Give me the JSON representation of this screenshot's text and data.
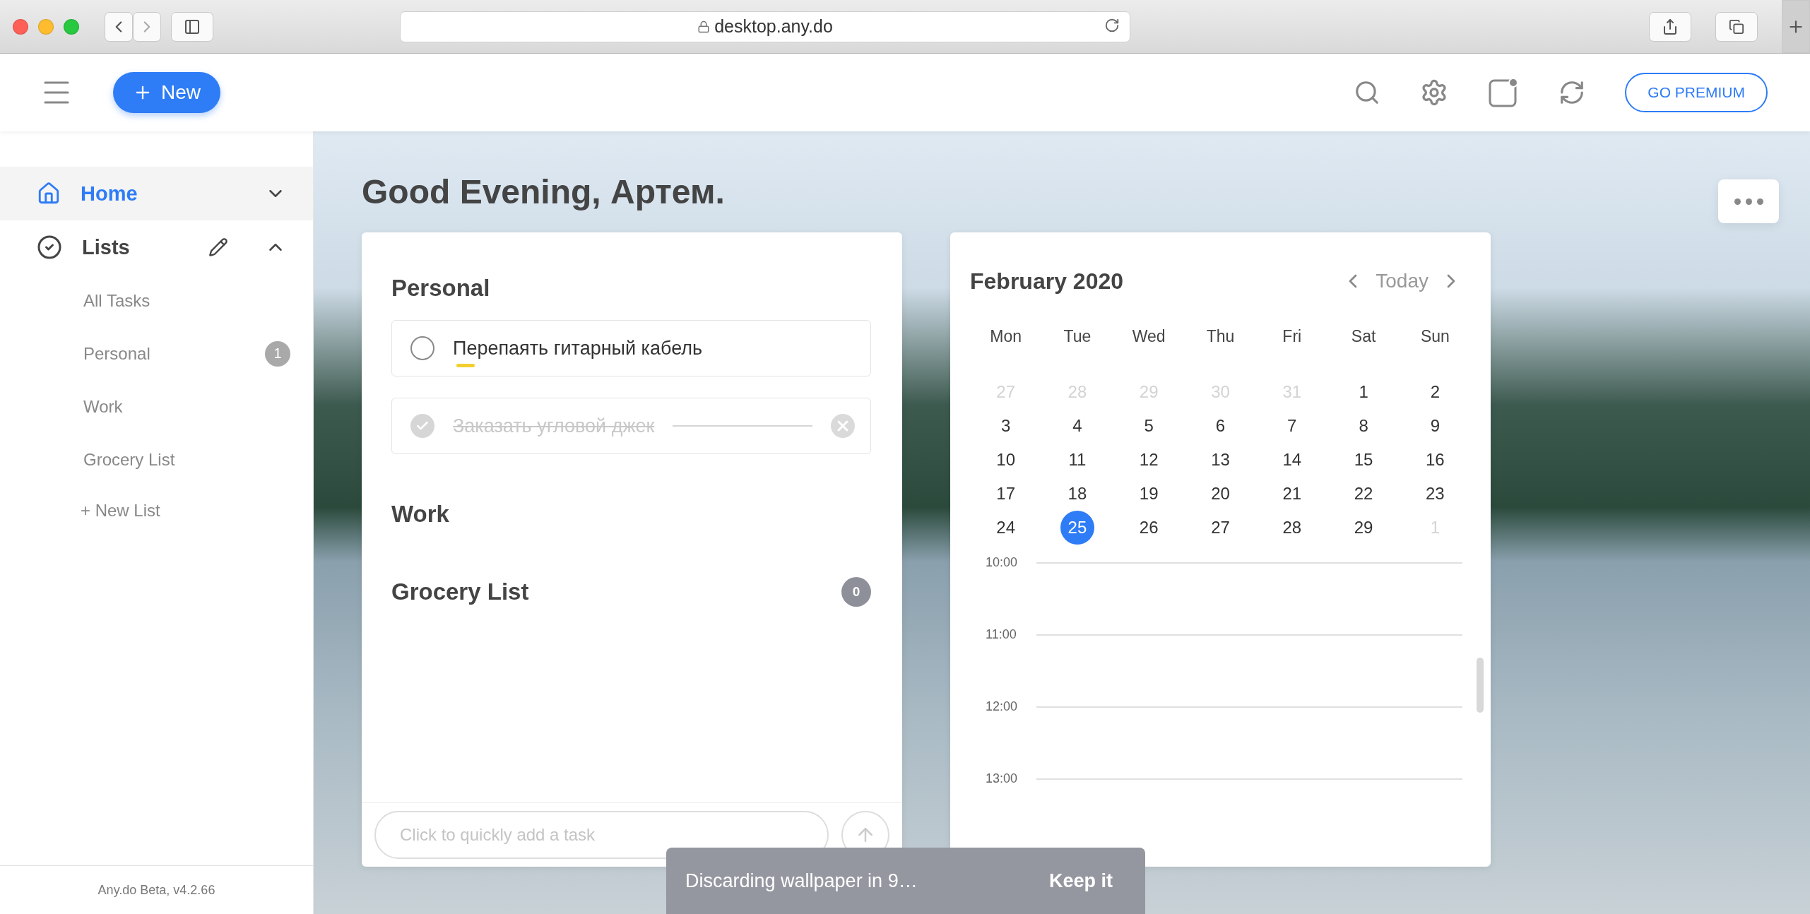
{
  "browser": {
    "url": "desktop.any.do"
  },
  "header": {
    "new_button": "New",
    "premium_button": "GO PREMIUM"
  },
  "sidebar": {
    "nav": [
      {
        "kind": "home",
        "label": "Home",
        "selected": true,
        "expanded": false
      },
      {
        "kind": "lists",
        "label": "Lists",
        "selected": false,
        "expanded": true
      }
    ],
    "lists": [
      {
        "label": "All Tasks",
        "selected": false
      },
      {
        "label": "Personal",
        "selected": false,
        "count": "1"
      },
      {
        "label": "Work",
        "selected": false
      },
      {
        "label": "Grocery List",
        "selected": false
      }
    ],
    "new_list": "+ New List",
    "footer": "Any.do Beta, v4.2.66"
  },
  "main": {
    "greeting": "Good Evening, Артем.",
    "lists_card": {
      "sections": [
        {
          "title": "Personal",
          "tasks": [
            {
              "text": "Перепаять гитарный кабель",
              "checked": false,
              "flagged": true
            },
            {
              "text": "Заказать угловой джек",
              "checked": true,
              "flagged": false
            }
          ]
        },
        {
          "title": "Work"
        },
        {
          "title": "Grocery List",
          "count": "0"
        }
      ],
      "quick_add": {
        "placeholder": "Click to quickly add a task"
      }
    },
    "calendar": {
      "title": "February 2020",
      "today": "Today",
      "weekdays": [
        "Mon",
        "Tue",
        "Wed",
        "Thu",
        "Fri",
        "Sat",
        "Sun"
      ],
      "days": [
        {
          "label": "27",
          "muted": true,
          "selected": false
        },
        {
          "label": "28",
          "muted": true,
          "selected": false
        },
        {
          "label": "29",
          "muted": true,
          "selected": false
        },
        {
          "label": "30",
          "muted": true,
          "selected": false
        },
        {
          "label": "31",
          "muted": true,
          "selected": false
        },
        {
          "label": "1",
          "muted": false,
          "selected": false
        },
        {
          "label": "2",
          "muted": false,
          "selected": false
        },
        {
          "label": "3",
          "muted": false,
          "selected": false
        },
        {
          "label": "4",
          "muted": false,
          "selected": false
        },
        {
          "label": "5",
          "muted": false,
          "selected": false
        },
        {
          "label": "6",
          "muted": false,
          "selected": false
        },
        {
          "label": "7",
          "muted": false,
          "selected": false
        },
        {
          "label": "8",
          "muted": false,
          "selected": false
        },
        {
          "label": "9",
          "muted": false,
          "selected": false
        },
        {
          "label": "10",
          "muted": false,
          "selected": false
        },
        {
          "label": "11",
          "muted": false,
          "selected": false
        },
        {
          "label": "12",
          "muted": false,
          "selected": false
        },
        {
          "label": "13",
          "muted": false,
          "selected": false
        },
        {
          "label": "14",
          "muted": false,
          "selected": false
        },
        {
          "label": "15",
          "muted": false,
          "selected": false
        },
        {
          "label": "16",
          "muted": false,
          "selected": false
        },
        {
          "label": "17",
          "muted": false,
          "selected": false
        },
        {
          "label": "18",
          "muted": false,
          "selected": false
        },
        {
          "label": "19",
          "muted": false,
          "selected": false
        },
        {
          "label": "20",
          "muted": false,
          "selected": false
        },
        {
          "label": "21",
          "muted": false,
          "selected": false
        },
        {
          "label": "22",
          "muted": false,
          "selected": false
        },
        {
          "label": "23",
          "muted": false,
          "selected": false
        },
        {
          "label": "24",
          "muted": false,
          "selected": false
        },
        {
          "label": "25",
          "muted": false,
          "selected": true
        },
        {
          "label": "26",
          "muted": false,
          "selected": false
        },
        {
          "label": "27",
          "muted": false,
          "selected": false
        },
        {
          "label": "28",
          "muted": false,
          "selected": false
        },
        {
          "label": "29",
          "muted": false,
          "selected": false
        },
        {
          "label": "1",
          "muted": true,
          "selected": false
        }
      ],
      "times": [
        "10:00",
        "11:00",
        "12:00",
        "13:00"
      ]
    },
    "toast": {
      "message": "Discarding wallpaper in 9…",
      "action": "Keep it"
    }
  }
}
